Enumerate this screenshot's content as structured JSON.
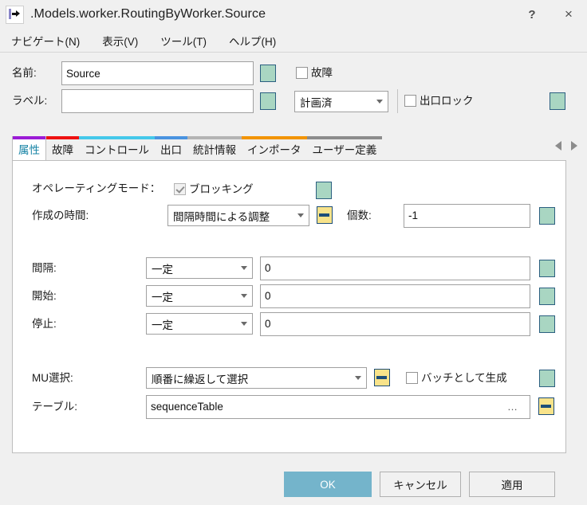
{
  "window": {
    "title": ".Models.worker.RoutingByWorker.Source",
    "icon": "source-arrow-icon",
    "help_label": "?",
    "close_label": "×"
  },
  "menubar": {
    "items": [
      {
        "label": "ナビゲート(N)"
      },
      {
        "label": "表示(V)"
      },
      {
        "label": "ツール(T)"
      },
      {
        "label": "ヘルプ(H)"
      }
    ]
  },
  "header": {
    "name_label": "名前:",
    "name_value": "Source",
    "label_label": "ラベル:",
    "label_value": "",
    "failure_checkbox": "故障",
    "failure_checked": false,
    "plan_combo_value": "計画済",
    "exitlock_checkbox": "出口ロック",
    "exitlock_checked": false
  },
  "tabs": {
    "items": [
      {
        "label": "属性",
        "color": "#9b1bd6",
        "active": true
      },
      {
        "label": "故障",
        "color": "#ee1111",
        "active": false
      },
      {
        "label": "コントロール",
        "color": "#45c8ea",
        "active": false
      },
      {
        "label": "出口",
        "color": "#4a93e0",
        "active": false
      },
      {
        "label": "統計情報",
        "color": "#b4b4b4",
        "active": false
      },
      {
        "label": "インポータ",
        "color": "#f29400",
        "active": false
      },
      {
        "label": "ユーザー定義",
        "color": "#8c8c8c",
        "active": false
      }
    ],
    "nav_prev": "scroll-tabs-left",
    "nav_next": "scroll-tabs-right"
  },
  "attributes": {
    "operating_mode_label": "オペレーティングモード：",
    "blocking_checkbox": "ブロッキング",
    "blocking_checked": true,
    "creation_time_label": "作成の時間:",
    "creation_time_value": "間隔時間による調整",
    "quantity_label": "個数:",
    "quantity_value": "-1",
    "rows": [
      {
        "label": "間隔:",
        "mode": "一定",
        "value": "0"
      },
      {
        "label": "開始:",
        "mode": "一定",
        "value": "0"
      },
      {
        "label": "停止:",
        "mode": "一定",
        "value": "0"
      }
    ],
    "mu_label": "MU選択:",
    "mu_value": "順番に繰返して選択",
    "batch_checkbox": "バッチとして生成",
    "batch_checked": false,
    "table_label": "テーブル:",
    "table_value": "sequenceTable",
    "table_browse": "…"
  },
  "footer": {
    "ok_label": "OK",
    "cancel_label": "キャンセル",
    "apply_label": "適用"
  },
  "colors": {
    "accent": "#74b4cb",
    "teal_square": "#a9d6c2",
    "yellow_square": "#f8e38a",
    "active_tab_text": "#1683a5",
    "window_bg": "#f0f0f0"
  }
}
